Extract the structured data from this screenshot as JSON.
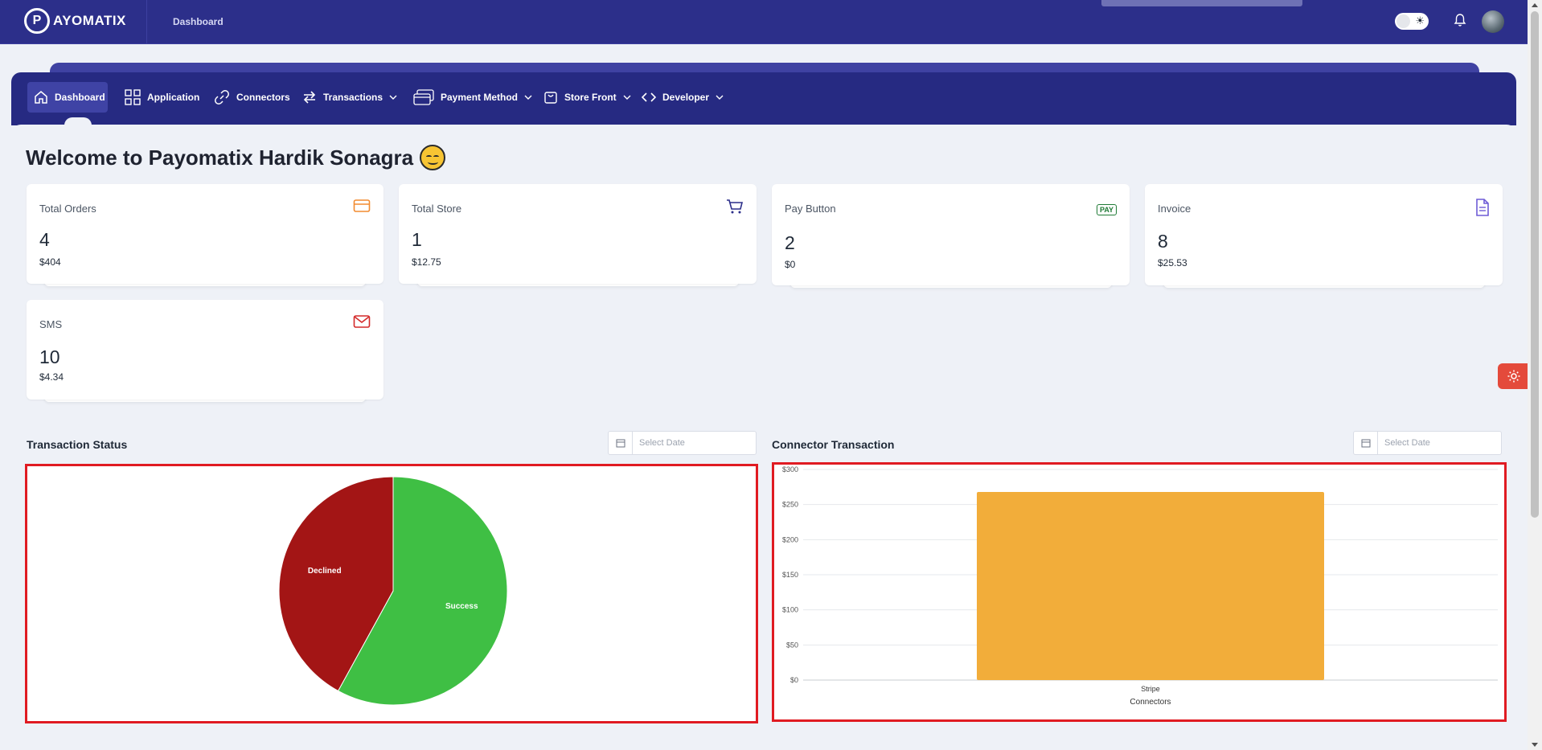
{
  "header": {
    "logo_letter": "P",
    "logo_text": "AYOMATIX",
    "breadcrumb": "Dashboard",
    "theme_toggle_icon": "sun-icon",
    "notification_icon": "bell-icon"
  },
  "nav": {
    "items": [
      {
        "label": "Dashboard",
        "icon": "home-icon",
        "active": true
      },
      {
        "label": "Application",
        "icon": "grid-icon"
      },
      {
        "label": "Connectors",
        "icon": "link-icon"
      },
      {
        "label": "Transactions",
        "icon": "arrows-exchange-icon",
        "dropdown": true
      },
      {
        "label": "Payment Method",
        "icon": "cards-icon",
        "dropdown": true
      },
      {
        "label": "Store Front",
        "icon": "bag-icon",
        "dropdown": true
      },
      {
        "label": "Developer",
        "icon": "code-icon",
        "dropdown": true
      }
    ]
  },
  "welcome": "Welcome to Payomatix Hardik Sonagra",
  "cards": [
    {
      "title": "Total Orders",
      "count": "4",
      "amount": "$404",
      "icon": "credit-card-icon",
      "color": "#f28b30"
    },
    {
      "title": "Total Store",
      "count": "1",
      "amount": "$12.75",
      "icon": "cart-icon",
      "color": "#2c2f8a"
    },
    {
      "title": "Pay Button",
      "count": "2",
      "amount": "$0",
      "icon": "pay-badge-icon",
      "badge": "PAY",
      "color": "#1f7a35"
    },
    {
      "title": "Invoice",
      "count": "8",
      "amount": "$25.53",
      "icon": "document-icon",
      "color": "#6e5bd6"
    },
    {
      "title": "SMS",
      "count": "10",
      "amount": "$4.34",
      "icon": "mail-icon",
      "color": "#d42a2a"
    }
  ],
  "transaction_status": {
    "title": "Transaction Status",
    "date_placeholder": "Select Date"
  },
  "connector_transaction": {
    "title": "Connector Transaction",
    "date_placeholder": "Select Date"
  },
  "chart_data": [
    {
      "type": "pie",
      "title": "Transaction Status",
      "categories": [
        "Declined",
        "Success"
      ],
      "values": [
        42,
        58
      ],
      "colors": [
        "#a31515",
        "#3fbf44"
      ]
    },
    {
      "type": "bar",
      "title": "Connector Transaction",
      "categories": [
        "Stripe"
      ],
      "values": [
        268
      ],
      "xlabel": "Connectors",
      "ylabel": "",
      "ylim": [
        0,
        300
      ],
      "y_ticks": [
        "$0",
        "$50",
        "$100",
        "$150",
        "$200",
        "$250",
        "$300"
      ],
      "grid": true,
      "colors": [
        "#f2ad3a"
      ]
    }
  ]
}
